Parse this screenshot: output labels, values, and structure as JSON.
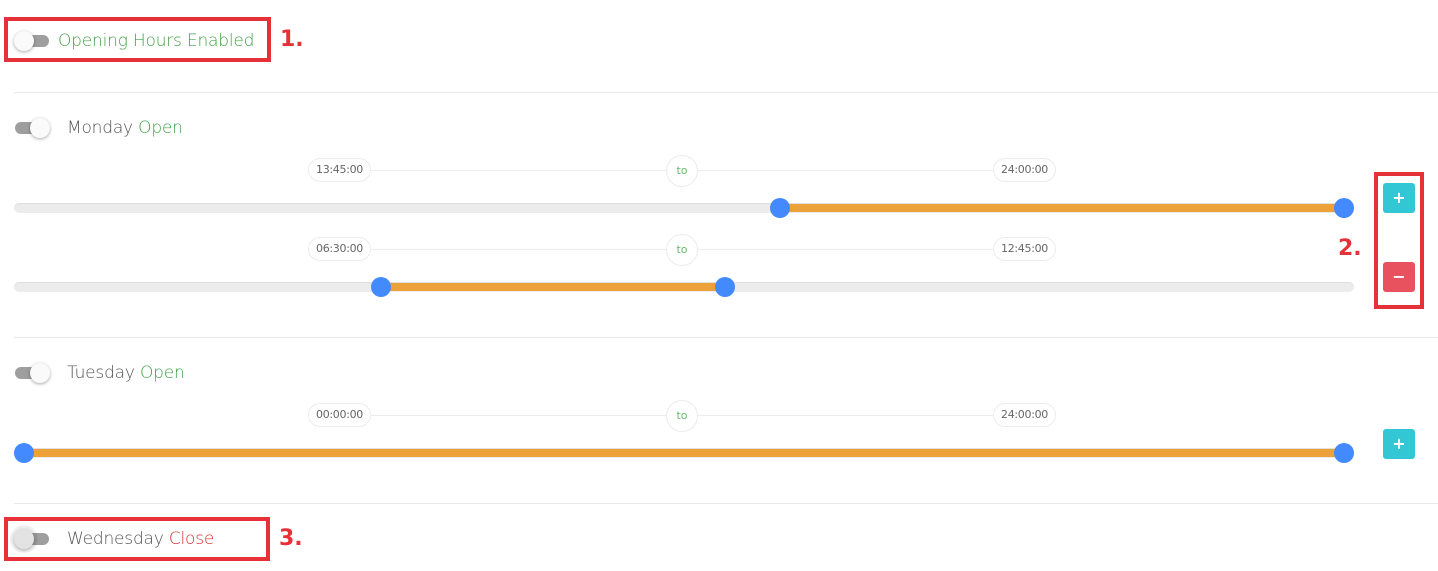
{
  "master": {
    "enabled": false,
    "label": "Opening Hours Enabled"
  },
  "days": [
    {
      "name": "Monday",
      "state_label": "Open",
      "open": true,
      "ranges": [
        {
          "from": "13:45:00",
          "separator": "to",
          "to": "24:00:00",
          "from_fraction": 0.5729,
          "to_fraction": 1.0
        },
        {
          "from": "06:30:00",
          "separator": "to",
          "to": "12:45:00",
          "from_fraction": 0.2708,
          "to_fraction": 0.5313
        }
      ],
      "add_label": "+",
      "remove_label": "−"
    },
    {
      "name": "Tuesday",
      "state_label": "Open",
      "open": true,
      "ranges": [
        {
          "from": "00:00:00",
          "separator": "to",
          "to": "24:00:00",
          "from_fraction": 0.0,
          "to_fraction": 1.0
        }
      ],
      "add_label": "+"
    },
    {
      "name": "Wednesday",
      "state_label": "Close",
      "open": false
    }
  ],
  "annotations": [
    "1.",
    "2.",
    "3."
  ],
  "colors": {
    "accent_fill": "#eca238",
    "handle": "#448aff",
    "add_button": "#33c6d4",
    "remove_button": "#e8525f",
    "open_text": "#43a047",
    "close_text": "#d32f2f",
    "annotation": "#e53238"
  }
}
